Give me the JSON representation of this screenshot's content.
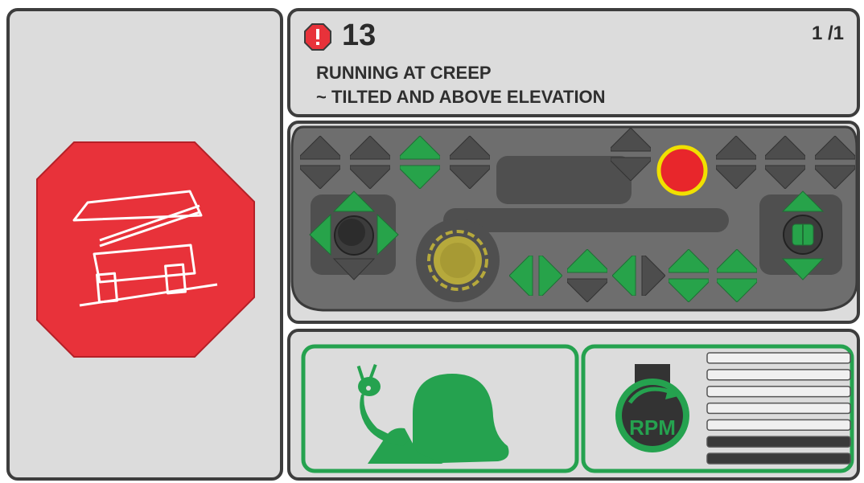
{
  "alarm": {
    "code": "13",
    "page": "1 /1",
    "message_line_1": "RUNNING AT CREEP",
    "message_line_2": "~ TILTED AND ABOVE ELEVATION",
    "severity_color": "#e8323a"
  },
  "status": {
    "creep_icon": "snail-icon",
    "engine_icon": "rpm-icon",
    "engine_label": "RPM",
    "rpm_level_bars_filled": 2,
    "rpm_level_bars_total": 7,
    "indicator_color": "#25a24f"
  },
  "controls": {
    "stop_indicator_color": "#e8262b",
    "stop_indicator_ring": "#f0e000",
    "active_color": "#27a34a",
    "inactive_color": "#4d4d4d"
  },
  "left": {
    "warning_icon": "tilted-machine-stop-icon",
    "warning_color": "#e8323a"
  }
}
